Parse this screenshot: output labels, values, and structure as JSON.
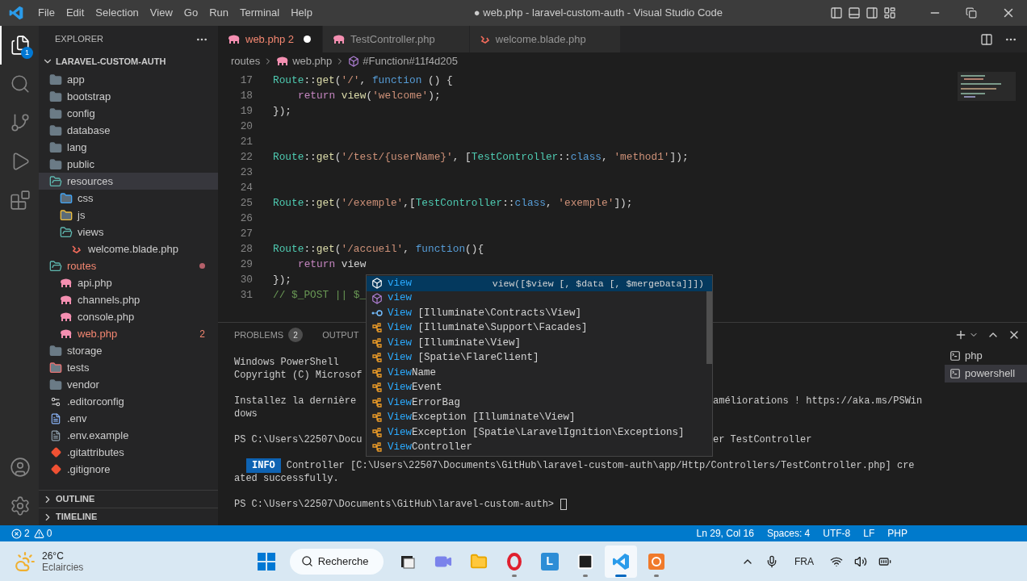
{
  "title_bar": {
    "menu": [
      "File",
      "Edit",
      "Selection",
      "View",
      "Go",
      "Run",
      "Terminal",
      "Help"
    ],
    "title": "● web.php - laravel-custom-auth - Visual Studio Code"
  },
  "activity_bar": [
    {
      "kind": "files",
      "selected": true,
      "badge": "1"
    },
    {
      "kind": "search",
      "selected": false
    },
    {
      "kind": "scm",
      "selected": false
    },
    {
      "kind": "debug",
      "selected": false
    },
    {
      "kind": "extensions",
      "selected": false
    },
    {
      "kind": "account",
      "selected": false
    },
    {
      "kind": "settings",
      "selected": false
    }
  ],
  "sidebar": {
    "title": "EXPLORER",
    "root": "LARAVEL-CUSTOM-AUTH",
    "items": [
      {
        "name": "app",
        "kind": "folder",
        "expanded": false,
        "selected": false,
        "problem": false
      },
      {
        "name": "bootstrap",
        "kind": "folder",
        "expanded": false,
        "selected": false,
        "problem": false
      },
      {
        "name": "config",
        "kind": "folder",
        "expanded": false,
        "selected": false,
        "problem": false
      },
      {
        "name": "database",
        "kind": "folder",
        "expanded": false,
        "selected": false,
        "problem": false
      },
      {
        "name": "lang",
        "kind": "folder",
        "expanded": false,
        "selected": false,
        "problem": false
      },
      {
        "name": "public",
        "kind": "folder",
        "expanded": false,
        "selected": false,
        "problem": false
      },
      {
        "name": "resources",
        "kind": "folder",
        "expanded": true,
        "selected": true,
        "problem": false,
        "children": [
          {
            "name": "css",
            "kind": "css-folder",
            "expanded": false,
            "selected": false,
            "problem": false
          },
          {
            "name": "js",
            "kind": "js-folder",
            "expanded": false,
            "selected": false,
            "problem": false
          },
          {
            "name": "views",
            "kind": "folder",
            "expanded": true,
            "selected": false,
            "problem": false,
            "children": [
              {
                "name": "welcome.blade.php",
                "kind": "blade",
                "selected": false,
                "problem": false
              }
            ]
          }
        ]
      },
      {
        "name": "routes",
        "kind": "folder",
        "expanded": true,
        "selected": false,
        "problem": true,
        "children": [
          {
            "name": "api.php",
            "kind": "php",
            "selected": false,
            "problem": false
          },
          {
            "name": "channels.php",
            "kind": "php",
            "selected": false,
            "problem": false
          },
          {
            "name": "console.php",
            "kind": "php",
            "selected": false,
            "problem": false
          },
          {
            "name": "web.php",
            "kind": "php",
            "selected": false,
            "problem": true,
            "badge": "2"
          }
        ]
      },
      {
        "name": "storage",
        "kind": "folder",
        "expanded": false,
        "selected": false,
        "problem": false
      },
      {
        "name": "tests",
        "kind": "test-folder",
        "expanded": false,
        "selected": false,
        "problem": false
      },
      {
        "name": "vendor",
        "kind": "folder",
        "expanded": false,
        "selected": false,
        "problem": false
      },
      {
        "name": ".editorconfig",
        "kind": "config",
        "selected": false,
        "problem": false
      },
      {
        "name": ".env",
        "kind": "env",
        "selected": false,
        "problem": false
      },
      {
        "name": ".env.example",
        "kind": "file",
        "selected": false,
        "problem": false
      },
      {
        "name": ".gitattributes",
        "kind": "git",
        "selected": false,
        "problem": false
      },
      {
        "name": ".gitignore",
        "kind": "git",
        "selected": false,
        "problem": false
      }
    ],
    "sections": [
      "OUTLINE",
      "TIMELINE"
    ]
  },
  "tabs": [
    {
      "label": "web.php",
      "badge": "2",
      "kind": "php",
      "modified": true,
      "problem": true,
      "selected": true
    },
    {
      "label": "TestController.php",
      "kind": "php",
      "modified": false,
      "problem": false,
      "selected": false
    },
    {
      "label": "welcome.blade.php",
      "kind": "blade",
      "modified": false,
      "problem": false,
      "selected": false
    }
  ],
  "breadcrumbs": [
    {
      "kind": "folder",
      "label": "routes"
    },
    {
      "kind": "php",
      "label": "web.php"
    },
    {
      "kind": "symbol",
      "label": "#Function#11f4d205"
    }
  ],
  "editor": {
    "lines": [
      {
        "number": "17",
        "indented": false,
        "tokens": [
          {
            "kind": "class",
            "text": "Route"
          },
          {
            "kind": "plain",
            "text": "::"
          },
          {
            "kind": "fn",
            "text": "get"
          },
          {
            "kind": "plain",
            "text": "("
          },
          {
            "kind": "str",
            "text": "'/'"
          },
          {
            "kind": "plain",
            "text": ", "
          },
          {
            "kind": "kw",
            "text": "function"
          },
          {
            "kind": "plain",
            "text": " () {"
          }
        ]
      },
      {
        "number": "18",
        "indented": true,
        "tokens": [
          {
            "kind": "ctrl",
            "text": "return"
          },
          {
            "kind": "fn",
            "text": "view"
          },
          {
            "kind": "plain",
            "text": "("
          },
          {
            "kind": "str",
            "text": "'welcome'"
          },
          {
            "kind": "plain",
            "text": ");"
          }
        ]
      },
      {
        "number": "19",
        "indented": false,
        "tokens": [
          {
            "kind": "plain",
            "text": "});"
          }
        ]
      },
      {
        "number": "20"
      },
      {
        "number": "21"
      },
      {
        "number": "22",
        "indented": false,
        "tokens": [
          {
            "kind": "class",
            "text": "Route"
          },
          {
            "kind": "plain",
            "text": "::"
          },
          {
            "kind": "fn",
            "text": "get"
          },
          {
            "kind": "plain",
            "text": "("
          },
          {
            "kind": "str",
            "text": "'/test/{userName}'"
          },
          {
            "kind": "plain",
            "text": ", ["
          },
          {
            "kind": "class",
            "text": "TestController"
          },
          {
            "kind": "plain",
            "text": "::"
          },
          {
            "kind": "kw",
            "text": "class"
          },
          {
            "kind": "plain",
            "text": ", "
          },
          {
            "kind": "str",
            "text": "'method1'"
          },
          {
            "kind": "plain",
            "text": "]);"
          }
        ]
      },
      {
        "number": "23"
      },
      {
        "number": "24"
      },
      {
        "number": "25",
        "indented": false,
        "tokens": [
          {
            "kind": "class",
            "text": "Route"
          },
          {
            "kind": "plain",
            "text": "::"
          },
          {
            "kind": "fn",
            "text": "get"
          },
          {
            "kind": "plain",
            "text": "("
          },
          {
            "kind": "str",
            "text": "'/exemple'"
          },
          {
            "kind": "plain",
            "text": ",["
          },
          {
            "kind": "class",
            "text": "TestController"
          },
          {
            "kind": "plain",
            "text": "::"
          },
          {
            "kind": "kw",
            "text": "class"
          },
          {
            "kind": "plain",
            "text": ", "
          },
          {
            "kind": "str",
            "text": "'exemple'"
          },
          {
            "kind": "plain",
            "text": "]);"
          }
        ]
      },
      {
        "number": "26"
      },
      {
        "number": "27"
      },
      {
        "number": "28",
        "indented": false,
        "tokens": [
          {
            "kind": "class",
            "text": "Route"
          },
          {
            "kind": "plain",
            "text": "::"
          },
          {
            "kind": "fn",
            "text": "get"
          },
          {
            "kind": "plain",
            "text": "("
          },
          {
            "kind": "str",
            "text": "'/accueil'"
          },
          {
            "kind": "plain",
            "text": ", "
          },
          {
            "kind": "kw",
            "text": "function"
          },
          {
            "kind": "plain",
            "text": "(){"
          }
        ]
      },
      {
        "number": "29",
        "indented": true,
        "tokens": [
          {
            "kind": "ctrl",
            "text": "return"
          },
          {
            "kind": "plain",
            "text": "view"
          }
        ]
      },
      {
        "number": "30",
        "indented": false,
        "tokens": [
          {
            "kind": "plain",
            "text": "});"
          }
        ]
      },
      {
        "number": "31",
        "indented": false,
        "tokens": [
          {
            "kind": "comment",
            "text": "// $_POST || $_"
          }
        ]
      }
    ]
  },
  "suggestions": [
    {
      "kind": "method",
      "match": "view",
      "selected": true,
      "detail": "view([$view [, $data [, $mergeData]]])"
    },
    {
      "kind": "method",
      "match": "view",
      "selected": false
    },
    {
      "kind": "interface",
      "match": "View",
      "qualifier": "[Illuminate\\Contracts\\View]",
      "selected": false
    },
    {
      "kind": "class",
      "match": "View",
      "qualifier": "[Illuminate\\Support\\Facades]",
      "selected": false
    },
    {
      "kind": "class",
      "match": "View",
      "qualifier": "[Illuminate\\View]",
      "selected": false
    },
    {
      "kind": "class",
      "match": "View",
      "qualifier": "[Spatie\\FlareClient]",
      "selected": false
    },
    {
      "kind": "class",
      "match": "View",
      "rest": "Name",
      "selected": false
    },
    {
      "kind": "class",
      "match": "View",
      "rest": "Event",
      "selected": false
    },
    {
      "kind": "class",
      "match": "View",
      "rest": "ErrorBag",
      "selected": false
    },
    {
      "kind": "class",
      "match": "View",
      "rest": "Exception",
      "qualifier": "[Illuminate\\View]",
      "selected": false
    },
    {
      "kind": "class",
      "match": "View",
      "rest": "Exception",
      "qualifier": "[Spatie\\LaravelIgnition\\Exceptions]",
      "selected": false
    },
    {
      "kind": "class",
      "match": "View",
      "rest": "Controller",
      "selected": false
    }
  ],
  "panel": {
    "tabs": [
      {
        "label": "PROBLEMS",
        "badge": "2",
        "selected": false
      },
      {
        "label": "OUTPUT",
        "selected": false
      }
    ],
    "terminal": [
      {
        "kind": "text",
        "left": "Windows PowerShell"
      },
      {
        "kind": "text",
        "left": "Copyright (C) Microsof"
      },
      {
        "kind": "blank"
      },
      {
        "kind": "text",
        "left": "Installez la dernière",
        "right": "améliorations ! https://aka.ms/PSWin"
      },
      {
        "kind": "text",
        "left": "dows"
      },
      {
        "kind": "blank"
      },
      {
        "kind": "text",
        "left": "PS C:\\Users\\22507\\Docu",
        "right": "er TestController"
      },
      {
        "kind": "blank"
      },
      {
        "kind": "info",
        "badge": "INFO",
        "left": "Controller [C:\\Users\\22507\\Documents\\GitHub\\laravel-custom-auth\\app/Http/Controllers/TestController.php] cre"
      },
      {
        "kind": "text",
        "left": "ated successfully."
      },
      {
        "kind": "blank"
      },
      {
        "kind": "prompt",
        "left": "PS C:\\Users\\22507\\Documents\\GitHub\\laravel-custom-auth>"
      }
    ],
    "terminals": [
      {
        "label": "php",
        "selected": false
      },
      {
        "label": "powershell",
        "selected": true
      }
    ]
  },
  "status_bar": {
    "errors": "2",
    "warnings": "0",
    "items": [
      "Ln 29, Col 16",
      "Spaces: 4",
      "UTF-8",
      "LF",
      "PHP"
    ]
  },
  "taskbar": {
    "temperature": "26°C",
    "weather": "Eclaircies",
    "search": "Recherche",
    "apps": [
      {
        "kind": "taskview",
        "open": false,
        "selected": false
      },
      {
        "kind": "chat",
        "open": false,
        "selected": false
      },
      {
        "kind": "files",
        "open": false,
        "selected": false
      },
      {
        "kind": "opera",
        "open": true,
        "selected": false
      },
      {
        "kind": "letter",
        "label": "L",
        "open": false,
        "selected": false
      },
      {
        "kind": "terminal",
        "open": true,
        "selected": false
      },
      {
        "kind": "vscode",
        "open": true,
        "selected": true
      },
      {
        "kind": "orange",
        "open": true,
        "selected": false
      }
    ],
    "language": "FRA"
  }
}
